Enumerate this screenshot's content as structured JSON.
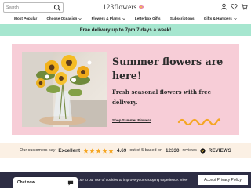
{
  "header": {
    "search_placeholder": "Search",
    "logo_text": "123flowers",
    "icons": [
      "search-icon",
      "user-icon",
      "heart-icon",
      "cart-icon"
    ]
  },
  "nav": {
    "items": [
      {
        "label": "Most Popular"
      },
      {
        "label": "Choose Occasion"
      },
      {
        "label": "Flowers & Plants"
      },
      {
        "label": "Letterbox Gifts"
      },
      {
        "label": "Subscriptions"
      },
      {
        "label": "Gifts & Hampers"
      }
    ]
  },
  "banner": {
    "text": "Free delivery up to 7pm 7 days a week!",
    "color": "#a6e6cf"
  },
  "hero": {
    "title": "Summer flowers are here!",
    "subtitle": "Fresh seasonal flowers with free delivery.",
    "cta": "Shop Summer Flowers",
    "background": "#f7cdd7",
    "accent": "#f5a623"
  },
  "reviews": {
    "prefix": "Our customers say",
    "rating_word": "Excellent",
    "rating": "4.69",
    "rating_text": "out of 5 based on",
    "count": "12330",
    "count_suffix": "reviews",
    "brand": "REVIEWS",
    "star_color": "#f5a623"
  },
  "cookie": {
    "text": "...se to our use of cookies to improve your shopping experience. View",
    "button": "Accept Privacy Policy"
  },
  "chat": {
    "label": "Chat now"
  }
}
